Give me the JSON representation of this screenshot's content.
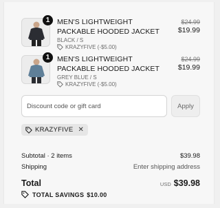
{
  "items": [
    {
      "quantity": "1",
      "name": "MEN'S LIGHTWEIGHT PACKABLE HOODED JACKET",
      "variant": "BLACK / S",
      "discount": "KRAZYFIVE (-$5.00)",
      "original_price": "$24.99",
      "price": "$19.99",
      "jacket_color": "#2b2d33"
    },
    {
      "quantity": "1",
      "name": "MEN'S LIGHTWEIGHT PACKABLE HOODED JACKET",
      "variant": "GREY BLUE / S",
      "discount": "KRAZYFIVE (-$5.00)",
      "original_price": "$24.99",
      "price": "$19.99",
      "jacket_color": "#5f7f98"
    }
  ],
  "discount": {
    "placeholder": "Discount code or gift card",
    "value": "",
    "apply_label": "Apply",
    "applied_code": "KRAZYFIVE"
  },
  "summary": {
    "subtotal_label": "Subtotal · 2 items",
    "subtotal_value": "$39.98",
    "shipping_label": "Shipping",
    "shipping_value": "Enter shipping address",
    "total_label": "Total",
    "currency": "USD",
    "total_value": "$39.98",
    "savings_label": "TOTAL SAVINGS",
    "savings_value": "$10.00"
  }
}
